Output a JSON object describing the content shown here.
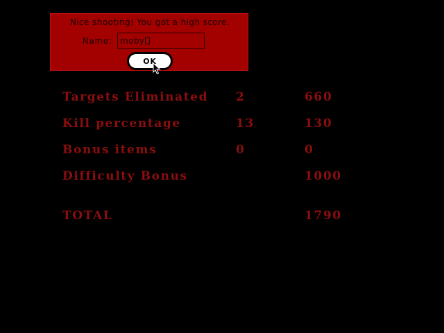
{
  "dialog": {
    "message": "Nice shooting! You got a high score.",
    "name_label": "Name:",
    "name_value": "moby",
    "ok_label": "OK"
  },
  "scores": {
    "rows": [
      {
        "label": "Targets Eliminated",
        "count": "2",
        "points": "660"
      },
      {
        "label": "Kill percentage",
        "count": "13",
        "points": "130"
      },
      {
        "label": "Bonus items",
        "count": "0",
        "points": "0"
      },
      {
        "label": "Difficulty Bonus",
        "count": "",
        "points": "1000"
      }
    ],
    "total": {
      "label": "TOTAL",
      "points": "1790"
    }
  },
  "colors": {
    "background": "#000000",
    "dialog": "#a30000",
    "score_text": "#8a0e0e",
    "button_face": "#ffffff"
  },
  "icons": {
    "pointer": "arrow-pointer-icon",
    "text_cursor": "text-cursor-icon"
  }
}
